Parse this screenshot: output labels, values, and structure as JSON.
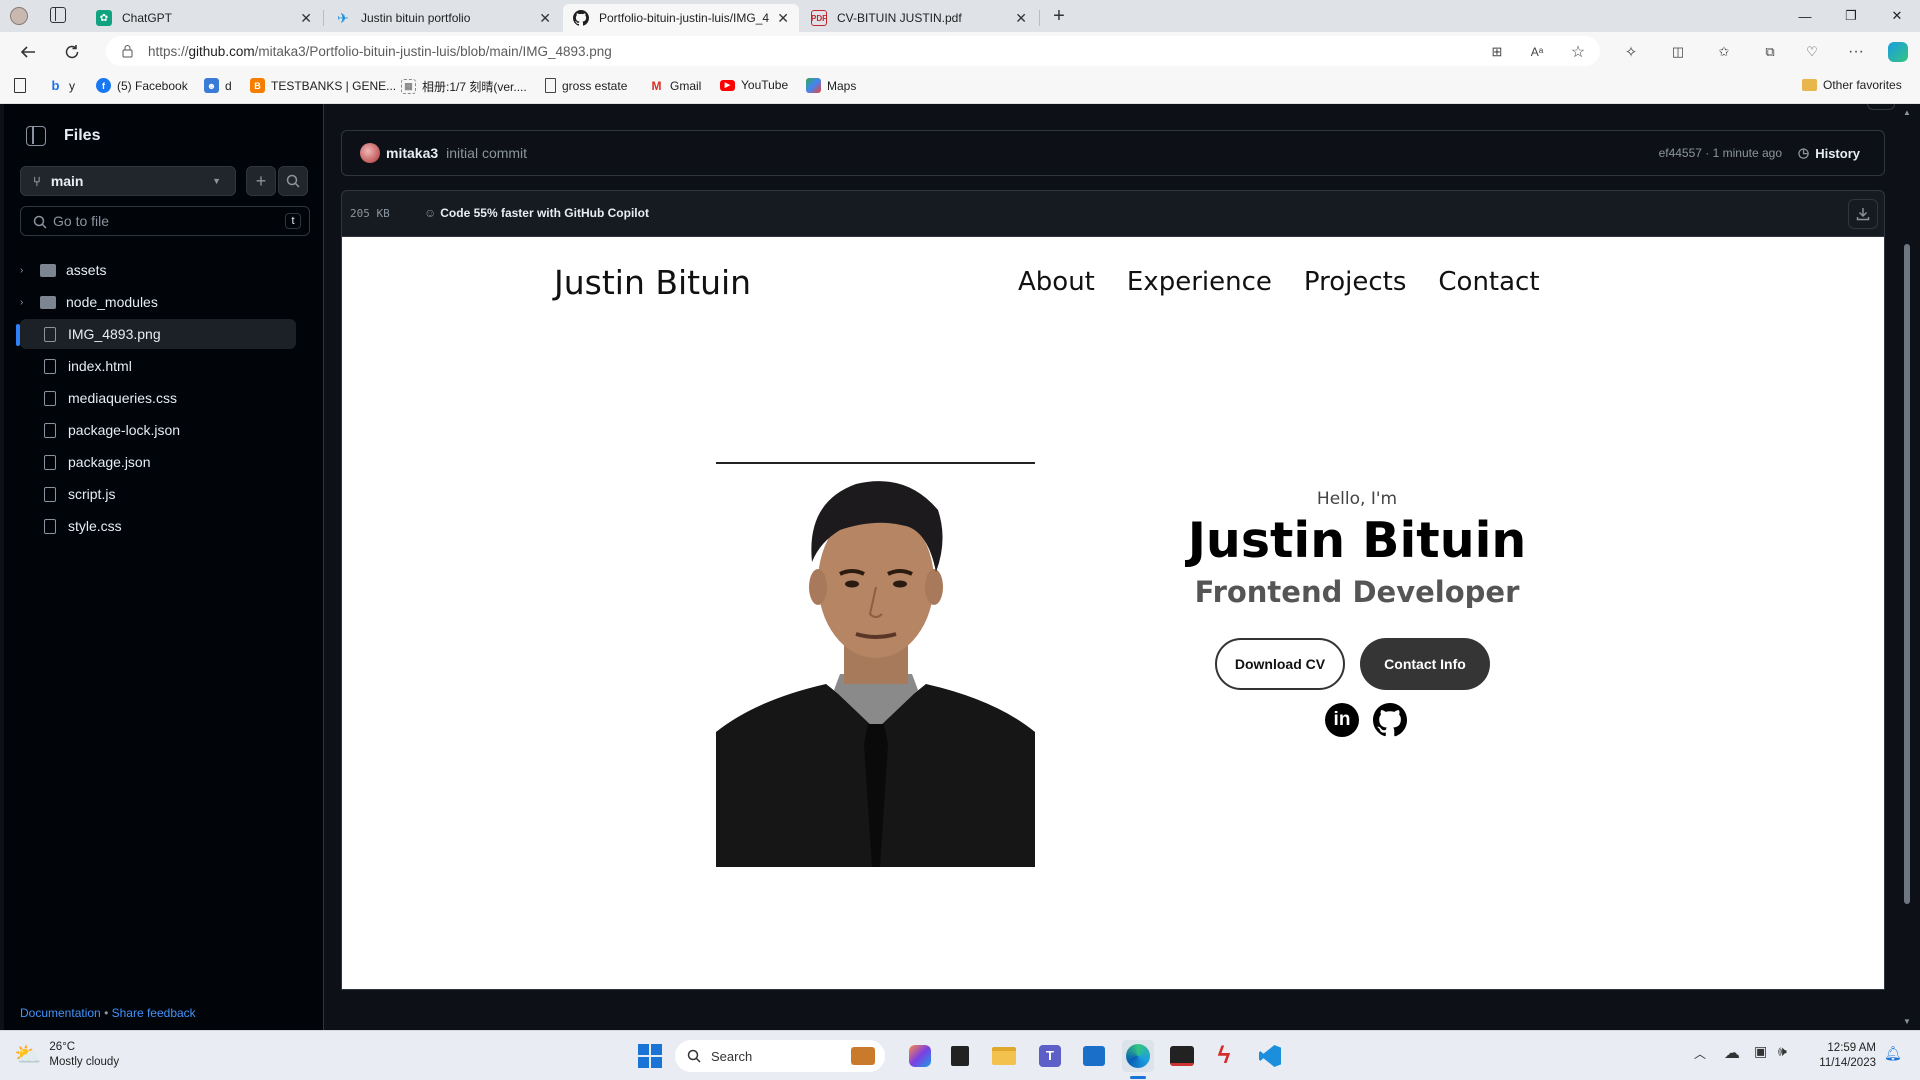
{
  "browser": {
    "tabs": [
      {
        "title": "ChatGPT",
        "icon": "chatgpt-icon"
      },
      {
        "title": "Justin bituin portfolio",
        "icon": "vscode-icon"
      },
      {
        "title": "Portfolio-bituin-justin-luis/IMG_4",
        "icon": "github-icon"
      },
      {
        "title": "CV-BITUIN JUSTIN.pdf",
        "icon": "pdf-icon"
      }
    ],
    "url_prefix": "https://",
    "url_host": "github.com",
    "url_path": "/mitaka3/Portfolio-bituin-justin-luis/blob/main/IMG_4893.png"
  },
  "favorites": {
    "items": [
      {
        "label": "y",
        "icon": "bing-icon"
      },
      {
        "label": "(5) Facebook",
        "icon": "facebook-icon"
      },
      {
        "label": "d",
        "icon": "people-icon"
      },
      {
        "label": "TESTBANKS | GENE...",
        "icon": "blogger-icon"
      },
      {
        "label": "相册:1/7 刻晴(ver....",
        "icon": "album-icon"
      },
      {
        "label": "gross estate",
        "icon": "page-icon"
      },
      {
        "label": "Gmail",
        "icon": "gmail-icon"
      },
      {
        "label": "YouTube",
        "icon": "youtube-icon"
      },
      {
        "label": "Maps",
        "icon": "maps-icon"
      }
    ],
    "other": "Other favorites"
  },
  "sidebar": {
    "title": "Files",
    "branch": "main",
    "search_placeholder": "Go to file",
    "search_shortcut": "t",
    "tree": [
      {
        "name": "assets",
        "type": "folder"
      },
      {
        "name": "node_modules",
        "type": "folder"
      },
      {
        "name": "IMG_4893.png",
        "type": "file",
        "selected": true
      },
      {
        "name": "index.html",
        "type": "file"
      },
      {
        "name": "mediaqueries.css",
        "type": "file"
      },
      {
        "name": "package-lock.json",
        "type": "file"
      },
      {
        "name": "package.json",
        "type": "file"
      },
      {
        "name": "script.js",
        "type": "file"
      },
      {
        "name": "style.css",
        "type": "file"
      }
    ],
    "footer_doc": "Documentation",
    "footer_sep": "•",
    "footer_feedback": "Share feedback"
  },
  "commit": {
    "author": "mitaka3",
    "message": "initial commit",
    "sha_time": "ef44557 · 1 minute ago",
    "history": "History"
  },
  "file": {
    "size": "205 KB",
    "copilot": "Code 55% faster with GitHub Copilot"
  },
  "portfolio": {
    "logo": "Justin Bituin",
    "nav": [
      "About",
      "Experience",
      "Projects",
      "Contact"
    ],
    "greeting": "Hello, I'm",
    "name": "Justin Bituin",
    "role": "Frontend Developer",
    "btn_download": "Download CV",
    "btn_contact": "Contact Info",
    "socials": [
      "linkedin-icon",
      "github-icon"
    ]
  },
  "taskbar": {
    "temp": "26°C",
    "weather": "Mostly cloudy",
    "search": "Search",
    "time": "12:59 AM",
    "date": "11/14/2023"
  }
}
